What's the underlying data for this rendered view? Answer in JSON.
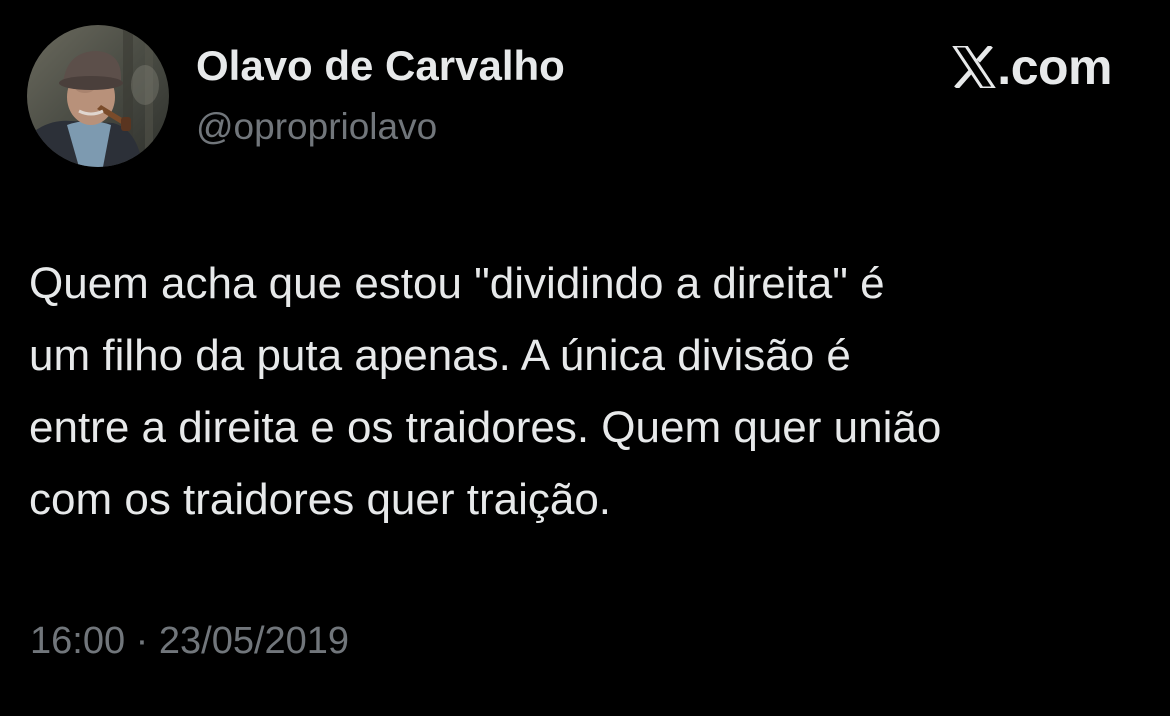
{
  "author": {
    "display_name": "Olavo de Carvalho",
    "handle": "@opropriolavo",
    "avatar_icon": "profile-photo-avatar"
  },
  "site_logo": {
    "icon": "x-logo-icon",
    "domain": ".com"
  },
  "tweet": {
    "text": "Quem acha que estou \"dividindo a direita\" é\num filho da puta apenas. A única divisão é\nentre a direita e os traidores. Quem quer união\ncom os traidores quer traição.",
    "time": "16:00",
    "separator": "·",
    "date": "23/05/2019"
  },
  "colors": {
    "background": "#000000",
    "primary_text": "#e7e9ea",
    "secondary_text": "#71767b"
  }
}
